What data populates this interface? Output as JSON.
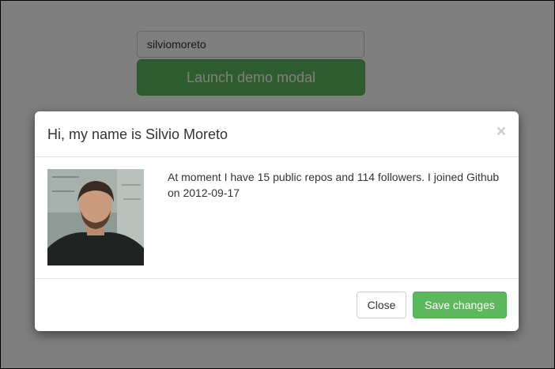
{
  "background": {
    "input_value": "silviomoreto",
    "launch_label": "Launch demo modal"
  },
  "modal": {
    "title": "Hi, my name is Silvio Moreto",
    "close_glyph": "×",
    "body_text": "At moment I have 15 public repos and 114 followers. I joined Github on 2012-09-17",
    "close_label": "Close",
    "save_label": "Save changes"
  },
  "colors": {
    "success": "#5cb85c",
    "backdrop": "rgba(0,0,0,0.5)"
  }
}
